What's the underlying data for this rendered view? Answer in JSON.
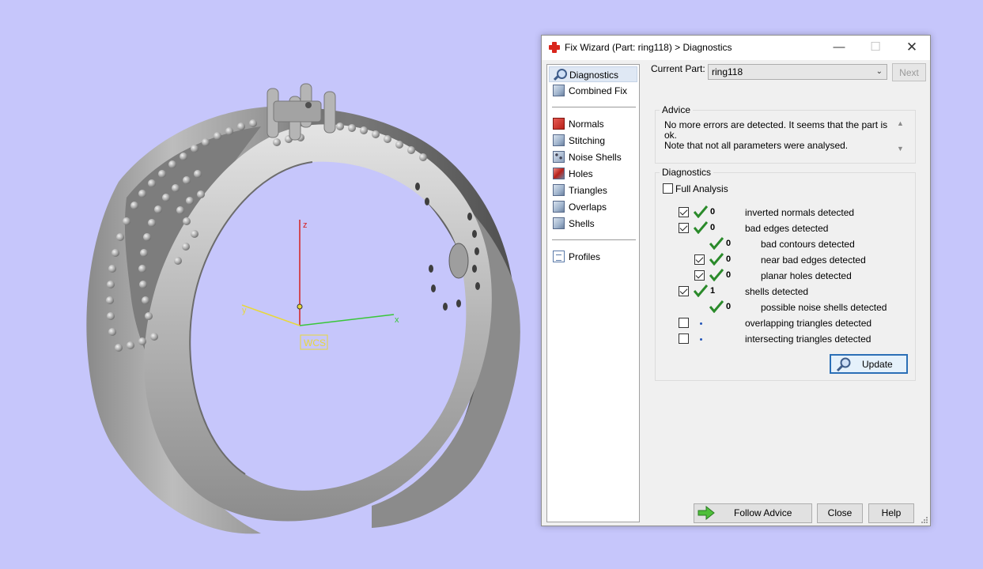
{
  "viewport": {
    "axis_z": "z",
    "axis_y": "y",
    "axis_x": "x",
    "wcs_label": "WCS"
  },
  "window": {
    "title": "Fix Wizard (Part: ring118) > Diagnostics",
    "minimize_glyph": "—",
    "maximize_glyph": "☐",
    "close_glyph": "✕"
  },
  "sidebar": {
    "items": [
      {
        "label": "Diagnostics",
        "icon": "magnifier-icon",
        "selected": true
      },
      {
        "label": "Combined Fix",
        "icon": "cube-icon"
      },
      {
        "label": "Normals",
        "icon": "normals-cube-icon"
      },
      {
        "label": "Stitching",
        "icon": "cube-icon"
      },
      {
        "label": "Noise Shells",
        "icon": "noise-shells-icon"
      },
      {
        "label": "Holes",
        "icon": "holes-cube-icon"
      },
      {
        "label": "Triangles",
        "icon": "cube-icon"
      },
      {
        "label": "Overlaps",
        "icon": "cube-icon"
      },
      {
        "label": "Shells",
        "icon": "cube-icon"
      },
      {
        "label": "Profiles",
        "icon": "document-icon"
      }
    ]
  },
  "header": {
    "current_part_label": "Current Part:",
    "current_part_value": "ring118",
    "next_label": "Next"
  },
  "advice": {
    "title": "Advice",
    "line1": "No more errors are detected. It seems that the part is ok.",
    "line2": "Note that not all parameters were analysed."
  },
  "diagnostics": {
    "title": "Diagnostics",
    "full_analysis_label": "Full Analysis",
    "full_analysis_checked": false,
    "rows": [
      {
        "checked": true,
        "status": "ok",
        "count": "0",
        "label": "inverted normals detected"
      },
      {
        "checked": true,
        "status": "ok",
        "count": "0",
        "label": "bad edges detected"
      },
      {
        "checked": null,
        "status": "ok",
        "count": "0",
        "label": "bad contours detected"
      },
      {
        "checked": true,
        "status": "ok",
        "count": "0",
        "label": "near bad edges detected"
      },
      {
        "checked": true,
        "status": "ok",
        "count": "0",
        "label": "planar holes detected"
      },
      {
        "checked": true,
        "status": "ok",
        "count": "1",
        "label": "shells detected"
      },
      {
        "checked": null,
        "status": "ok",
        "count": "0",
        "label": "possible noise shells detected"
      },
      {
        "checked": false,
        "status": "pending",
        "count": "",
        "label": "overlapping triangles detected"
      },
      {
        "checked": false,
        "status": "pending",
        "count": "",
        "label": "intersecting triangles detected"
      }
    ],
    "update_label": "Update"
  },
  "footer": {
    "follow_advice_label": "Follow Advice",
    "close_label": "Close",
    "help_label": "Help"
  },
  "colors": {
    "background": "#c6c6fb",
    "ok_check": "#2a8a2a",
    "accent": "#2b6fb6"
  }
}
